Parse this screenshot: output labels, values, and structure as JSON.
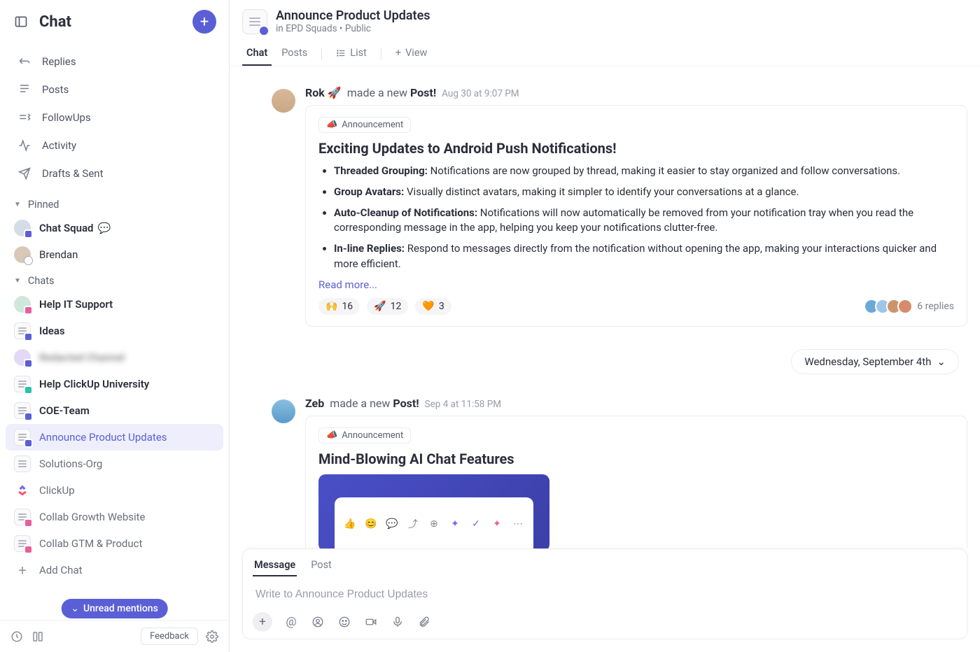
{
  "sidebar": {
    "title": "Chat",
    "nav": [
      {
        "label": "Replies",
        "icon": "reply-icon"
      },
      {
        "label": "Posts",
        "icon": "posts-icon"
      },
      {
        "label": "FollowUps",
        "icon": "followups-icon"
      },
      {
        "label": "Activity",
        "icon": "activity-icon"
      },
      {
        "label": "Drafts & Sent",
        "icon": "send-icon"
      }
    ],
    "pinned_label": "Pinned",
    "pinned": [
      {
        "label": "Chat Squad",
        "has_typing": true
      },
      {
        "label": "Brendan"
      }
    ],
    "chats_label": "Chats",
    "chats": [
      {
        "label": "Help IT Support",
        "bold": true
      },
      {
        "label": "Ideas",
        "bold": true
      },
      {
        "label": "Redacted Channel",
        "bold": true,
        "blurred": true
      },
      {
        "label": "Help ClickUp University",
        "bold": true
      },
      {
        "label": "COE-Team",
        "bold": true
      },
      {
        "label": "Announce Product Updates",
        "active": true
      },
      {
        "label": "Solutions-Org"
      },
      {
        "label": "ClickUp"
      },
      {
        "label": "Collab Growth Website"
      },
      {
        "label": "Collab GTM & Product"
      }
    ],
    "add_chat_label": "Add Chat",
    "unread_pill": "Unread mentions",
    "feedback_label": "Feedback"
  },
  "header": {
    "title": "Announce Product Updates",
    "breadcrumb_prefix": "in ",
    "breadcrumb_space": "EPD Squads",
    "breadcrumb_sep": " • ",
    "visibility": "Public",
    "tabs": {
      "chat": "Chat",
      "posts": "Posts",
      "list": "List",
      "view": "View"
    }
  },
  "feed": {
    "post1": {
      "author": "Rok",
      "emoji": "🚀",
      "action_prefix": "made a new ",
      "action_bold": "Post!",
      "time": "Aug 30 at 9:07 PM",
      "badge": "Announcement",
      "title": "Exciting Updates to Android Push Notifications!",
      "bullets": [
        {
          "b": "Threaded Grouping:",
          "t": " Notifications are now grouped by thread, making it easier to stay organized and follow conversations."
        },
        {
          "b": "Group Avatars:",
          "t": " Visually distinct avatars, making it simpler to identify your conversations at a glance."
        },
        {
          "b": "Auto-Cleanup of Notifications:",
          "t": " Notifications will now automatically be removed from your notification tray when you read the corresponding message in the app, helping you keep your notifications clutter-free."
        },
        {
          "b": "In-line Replies:",
          "t": " Respond to messages directly from the notification without opening the app, making your interactions quicker and more efficient."
        }
      ],
      "read_more": "Read more...",
      "reactions": [
        {
          "emoji": "🙌",
          "count": "16"
        },
        {
          "emoji": "🚀",
          "count": "12"
        },
        {
          "emoji": "🧡",
          "count": "3"
        }
      ],
      "replies": "6 replies"
    },
    "divider_date": "Wednesday, September 4th",
    "post2": {
      "author": "Zeb",
      "action_prefix": "made a new ",
      "action_bold": "Post!",
      "time": "Sep 4 at 11:58 PM",
      "badge": "Announcement",
      "title": "Mind-Blowing AI Chat Features"
    }
  },
  "composer": {
    "tabs": {
      "message": "Message",
      "post": "Post"
    },
    "placeholder": "Write to Announce Product Updates"
  }
}
